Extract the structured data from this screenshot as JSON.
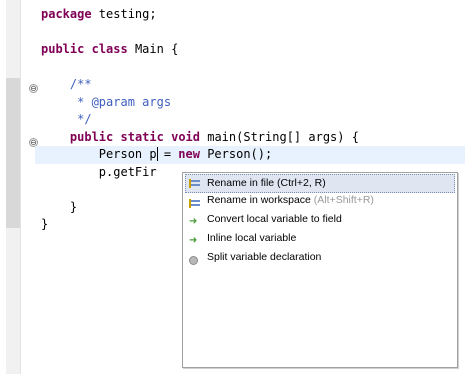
{
  "code_lines": [
    {
      "id": "l1",
      "parts": [
        {
          "t": "package",
          "c": "kw"
        },
        {
          "t": " testing;",
          "c": ""
        }
      ]
    },
    {
      "id": "l2",
      "parts": []
    },
    {
      "id": "l3",
      "parts": [
        {
          "t": "public",
          "c": "kw"
        },
        {
          "t": " ",
          "c": ""
        },
        {
          "t": "class",
          "c": "kw"
        },
        {
          "t": " Main {",
          "c": ""
        }
      ]
    },
    {
      "id": "l4",
      "parts": []
    },
    {
      "id": "l5",
      "parts": [
        {
          "t": "    /**",
          "c": "doc"
        }
      ]
    },
    {
      "id": "l6",
      "parts": [
        {
          "t": "     * @param args",
          "c": "doc"
        }
      ]
    },
    {
      "id": "l7",
      "parts": [
        {
          "t": "     */",
          "c": "doc"
        }
      ]
    },
    {
      "id": "l8",
      "parts": [
        {
          "t": "    ",
          "c": ""
        },
        {
          "t": "public",
          "c": "kw"
        },
        {
          "t": " ",
          "c": ""
        },
        {
          "t": "static",
          "c": "kw"
        },
        {
          "t": " ",
          "c": ""
        },
        {
          "t": "void",
          "c": "kw"
        },
        {
          "t": " main(String[] args) {",
          "c": ""
        }
      ]
    },
    {
      "id": "l9",
      "current": true,
      "parts": [
        {
          "t": "        Person p",
          "c": "",
          "cursor": true
        },
        {
          "t": " = ",
          "c": ""
        },
        {
          "t": "new",
          "c": "kw"
        },
        {
          "t": " Person();",
          "c": ""
        }
      ]
    },
    {
      "id": "l10",
      "parts": [
        {
          "t": "        p.getFir",
          "c": ""
        }
      ]
    },
    {
      "id": "l11",
      "parts": []
    },
    {
      "id": "l12",
      "parts": [
        {
          "t": "    }",
          "c": ""
        }
      ]
    },
    {
      "id": "l13",
      "parts": [
        {
          "t": "}",
          "c": ""
        }
      ]
    }
  ],
  "fold_markers": [
    "⊖",
    "⊖"
  ],
  "quick_assist": {
    "items": [
      {
        "label": "Rename in file",
        "hint": " (Ctrl+2, R)",
        "icon": "rename-icon",
        "selected": true
      },
      {
        "label": "Rename in workspace",
        "hint": " (Alt+Shift+R)",
        "icon": "rename-icon",
        "selected": false
      },
      {
        "label": "Convert local variable to field",
        "hint": "",
        "icon": "green-arrow-icon",
        "selected": false
      },
      {
        "label": "Inline local variable",
        "hint": "",
        "icon": "green-arrow-icon",
        "selected": false
      },
      {
        "label": "Split variable declaration",
        "hint": "",
        "icon": "gear-icon",
        "selected": false
      }
    ]
  },
  "colors": {
    "keyword": "#7f0055",
    "javadoc": "#3f5fbf",
    "current_line": "#e8f2fe",
    "selection": "#dfe6f2"
  }
}
